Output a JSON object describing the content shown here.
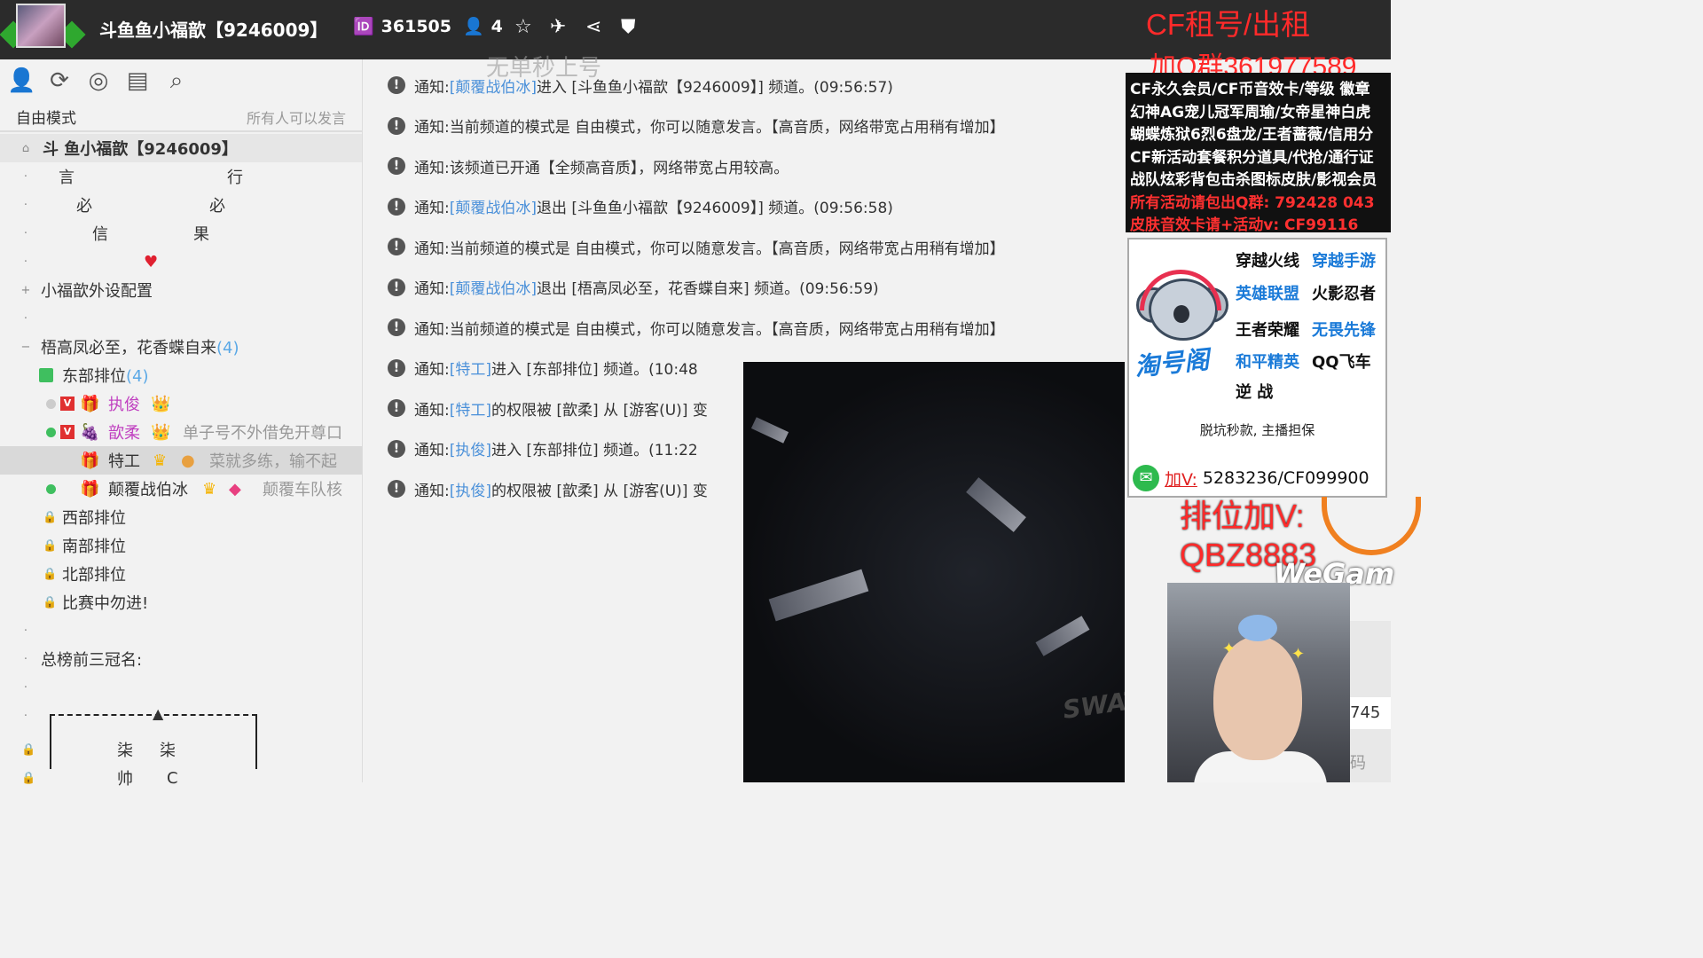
{
  "topbar": {
    "channel_title": "斗鱼鱼小福歆【9246009】",
    "listen_count": "361505",
    "online_count": "4",
    "ad_title": "CF租号/出租",
    "ad_qq": "加Q群361977589"
  },
  "sidebar": {
    "mode_label": "自由模式",
    "mode_perm": "所有人可以发言",
    "channel_name": "斗 鱼小福歆【9246009】",
    "rows": {
      "r1a": "言",
      "r1b": "行",
      "r2a": "必",
      "r2b": "必",
      "r3a": "信",
      "r3b": "果",
      "heart": "♥",
      "ext_config": "小福歆外设配置",
      "group_name": "梧高凤必至，花香蝶自来",
      "group_count": "(4)",
      "east_name": "东部排位",
      "east_count": "(4)",
      "user1_name": "执俊",
      "user2_name": "歆柔",
      "user2_sign": "单子号不外借免开尊口",
      "user3_name": "特工",
      "user3_sign": "菜就多练，输不起",
      "user4_name": "颠覆战伯冰",
      "user4_sign": "颠覆车队核",
      "west": "西部排位",
      "south": "南部排位",
      "north": "北部排位",
      "match": "比赛中勿进!",
      "top3": "总榜前三冠名:",
      "box_a": "柒",
      "box_b": "柒",
      "box_c": "帅",
      "box_d": "C"
    }
  },
  "messages": [
    {
      "prefix": "通知: ",
      "user": "[颠覆战伯冰]",
      "text": " 进入 [斗鱼鱼小福歆【9246009】] 频道。(09:56:57)"
    },
    {
      "prefix": "通知: ",
      "user": "",
      "text": "当前频道的模式是 自由模式，你可以随意发言。【高音质，网络带宽占用稍有增加】"
    },
    {
      "prefix": "通知: ",
      "user": "",
      "text": "该频道已开通【全频高音质】，网络带宽占用较高。"
    },
    {
      "prefix": "通知: ",
      "user": "[颠覆战伯冰]",
      "text": " 退出 [斗鱼鱼小福歆【9246009】] 频道。(09:56:58)"
    },
    {
      "prefix": "通知: ",
      "user": "",
      "text": "当前频道的模式是 自由模式，你可以随意发言。【高音质，网络带宽占用稍有增加】"
    },
    {
      "prefix": "通知: ",
      "user": "[颠覆战伯冰]",
      "text": " 退出 [梧高凤必至，花香蝶自来] 频道。(09:56:59)"
    },
    {
      "prefix": "通知: ",
      "user": "",
      "text": "当前频道的模式是 自由模式，你可以随意发言。【高音质，网络带宽占用稍有增加】"
    },
    {
      "prefix": "通知: ",
      "user": "[特工]",
      "text": " 进入 [东部排位] 频道。(10:48"
    },
    {
      "prefix": "通知: ",
      "user": "[特工]",
      "text": " 的权限被 [歆柔] 从 [游客(U)] 变"
    },
    {
      "prefix": "通知: ",
      "user": "[执俊]",
      "text": " 进入 [东部排位] 频道。(11:22"
    },
    {
      "prefix": "通知: ",
      "user": "[执俊]",
      "text": " 的权限被 [歆柔] 从 [游客(U)] 变"
    }
  ],
  "watermark": "无单秒上号",
  "ad_lines": [
    "CF永久会员/CF币音效卡/等级 徽章",
    "幻神AG宠儿冠军周瑜/女帝星神白虎",
    "蝴蝶炼狱6烈6盘龙/王者蔷薇/信用分",
    "CF新活动套餐积分道具/代抢/通行证",
    "战队炫彩背包击杀图标皮肤/影视会员",
    "所有活动请包出Q群: 792428 043",
    "皮肤音效卡请+活动v: CF99116"
  ],
  "card": {
    "brand": "淘号阁",
    "g1a": "穿越火线",
    "g1b": "穿越手游",
    "g2a": "英雄联盟",
    "g2b": "火影忍者",
    "g3a": "王者荣耀",
    "g3b": "无畏先锋",
    "g4a": "和平精英",
    "g4b": "QQ飞车",
    "g5a": "逆 战",
    "tagline": "脱坑秒款, 主播担保",
    "contact_label": "加V:",
    "contact_id": "5283236/CF099900"
  },
  "stream": {
    "rank_line1": "排位加V:",
    "rank_line2": "QBZ8883",
    "wegame": "WeGam",
    "side_num": "745",
    "side_code": "码",
    "swat": "SWAT"
  },
  "colors": {
    "accent_blue": "#4a90d9",
    "ad_red": "#ff2a2a",
    "online_green": "#3fbf5f"
  }
}
